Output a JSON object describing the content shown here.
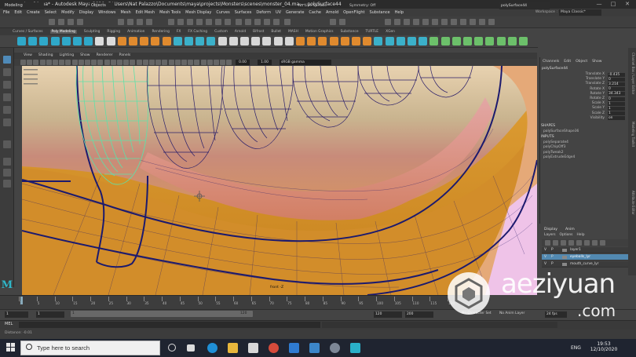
{
  "title": "monster_04.ma* - Autodesk Maya 2020: C:\\Users\\Nat Palazzo\\Documents\\maya\\projects\\Monsters\\scenes\\monster_04.ma  ---  polySurface44",
  "menubar": [
    "File",
    "Edit",
    "Create",
    "Select",
    "Modify",
    "Display",
    "Windows",
    "Mesh",
    "Edit Mesh",
    "Mesh Tools",
    "Mesh Display",
    "Curves",
    "Surfaces",
    "Deform",
    "UV",
    "Generate",
    "Cache",
    "Arnold",
    "OpenFlight",
    "Substance",
    "Help"
  ],
  "workspace": {
    "label": "Workspace :",
    "value": "Maya Classic*"
  },
  "statusline": {
    "mode": "Modeling",
    "objects": "Objects",
    "no_live": "No Live Surface",
    "symmetry": "Symmetry: Off",
    "object_name": "polySurface44"
  },
  "shelf_tabs": [
    {
      "label": "Curves / Surfaces",
      "active": false
    },
    {
      "label": "Poly Modeling",
      "active": true
    },
    {
      "label": "Sculpting",
      "active": false
    },
    {
      "label": "Rigging",
      "active": false
    },
    {
      "label": "Animation",
      "active": false
    },
    {
      "label": "Rendering",
      "active": false
    },
    {
      "label": "FX",
      "active": false
    },
    {
      "label": "FX Caching",
      "active": false
    },
    {
      "label": "Custom",
      "active": false
    },
    {
      "label": "Arnold",
      "active": false
    },
    {
      "label": "Bifrost",
      "active": false
    },
    {
      "label": "Bullet",
      "active": false
    },
    {
      "label": "MASH",
      "active": false
    },
    {
      "label": "Motion Graphics",
      "active": false
    },
    {
      "label": "Substance",
      "active": false
    },
    {
      "label": "TURTLE",
      "active": false
    },
    {
      "label": "XGen",
      "active": false
    }
  ],
  "panel_menu": [
    "View",
    "Shading",
    "Lighting",
    "Show",
    "Renderer",
    "Panels"
  ],
  "panel_tools": {
    "exposure": "0.00",
    "gamma": "1.00",
    "color_space": "sRGB gamma"
  },
  "viewport": {
    "camera": "front -Z"
  },
  "channel_box": {
    "menu": [
      "Channels",
      "Edit",
      "Object",
      "Show"
    ],
    "object": "polySurface44",
    "attributes": [
      {
        "name": "Translate X",
        "value": "-0.435"
      },
      {
        "name": "Translate Y",
        "value": "0"
      },
      {
        "name": "Translate Z",
        "value": "3.214"
      },
      {
        "name": "Rotate X",
        "value": "0"
      },
      {
        "name": "Rotate Y",
        "value": "34.343"
      },
      {
        "name": "Rotate Z",
        "value": "0"
      },
      {
        "name": "Scale X",
        "value": "1"
      },
      {
        "name": "Scale Y",
        "value": "1"
      },
      {
        "name": "Scale Z",
        "value": "1"
      },
      {
        "name": "Visibility",
        "value": "on"
      }
    ],
    "shapes_header": "SHAPES",
    "shape": "polySurfaceShape36",
    "inputs_header": "INPUTS",
    "inputs": [
      "polySeparate4",
      "polyChipOff3",
      "polyTweak2",
      "polyExtrudeEdge4"
    ]
  },
  "right_tabs": [
    "Channel Box / Layer Editor",
    "Modeling Toolkit",
    "Attribute Editor"
  ],
  "layer_editor": {
    "tabs": [
      "Display",
      "Anim"
    ],
    "menu": [
      "Layers",
      "Options",
      "Help"
    ],
    "layers": [
      {
        "v": "V",
        "p": "P",
        "name": "layer1",
        "selected": false
      },
      {
        "v": "V",
        "p": "P",
        "name": "eyeballs_lyr",
        "selected": true
      },
      {
        "v": "V",
        "p": "P",
        "name": "mouth_curve_lyr",
        "selected": false
      }
    ]
  },
  "time_slider": {
    "ticks": [
      "1",
      "5",
      "10",
      "15",
      "20",
      "25",
      "30",
      "35",
      "40",
      "45",
      "50",
      "55",
      "60",
      "65",
      "70",
      "75",
      "80",
      "85",
      "90",
      "95",
      "100",
      "105",
      "110",
      "115",
      "120"
    ]
  },
  "range_slider": {
    "start": "1",
    "start_inner": "1",
    "bar_start": "1",
    "bar_end": "120",
    "end_inner": "120",
    "end": "200",
    "no_character": "No Character Set",
    "no_anim": "No Anim Layer",
    "fps": "24 fps"
  },
  "command_line": {
    "label": "MEL"
  },
  "help_line": "Distance: -0.01",
  "taskbar": {
    "search_placeholder": "Type here to search",
    "lang": "ENG",
    "time": "19:53",
    "date": "12/10/2020"
  },
  "watermark": {
    "brand": "aeziyuan",
    "suffix": ".com"
  },
  "colors": {
    "accent": "#5289b1",
    "viewport_orange": "#d89a2c",
    "wire_dark": "#1c1a6e",
    "wire_selected": "#5fe0a8",
    "taskbar": "#1f2430"
  }
}
